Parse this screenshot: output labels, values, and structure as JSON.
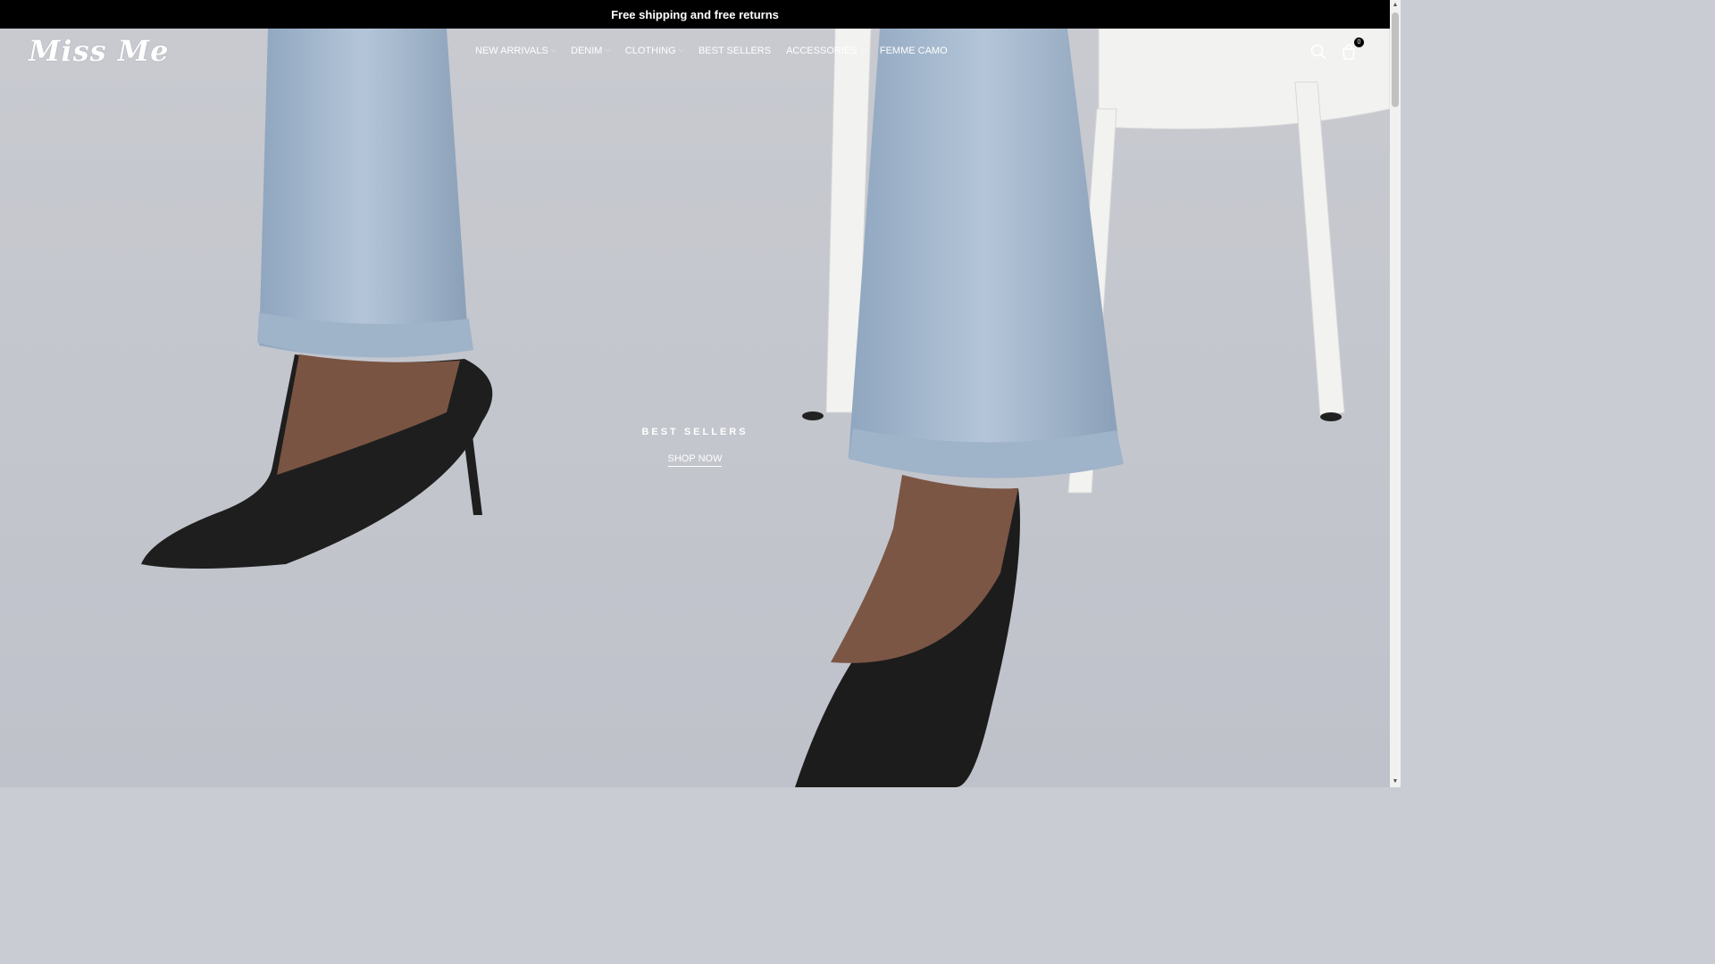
{
  "announcement": {
    "text": "Free shipping and free returns"
  },
  "brand": {
    "logo_text": "Miss Me"
  },
  "nav": {
    "items": [
      {
        "label": "NEW ARRIVALS",
        "has_dropdown": true
      },
      {
        "label": "DENIM",
        "has_dropdown": true
      },
      {
        "label": "CLOTHING",
        "has_dropdown": true
      },
      {
        "label": "BEST SELLERS",
        "has_dropdown": false
      },
      {
        "label": "ACCESSORIES",
        "has_dropdown": true
      },
      {
        "label": "FEMME CAMO",
        "has_dropdown": false
      }
    ]
  },
  "header_icons": {
    "search": "search-icon",
    "cart": "shopping-bag-icon",
    "cart_count": "0"
  },
  "hero": {
    "heading": "BEST SELLERS",
    "cta_label": "SHOP NOW"
  },
  "colors": {
    "announcement_bg": "#000000",
    "text_on_hero": "#ffffff"
  }
}
